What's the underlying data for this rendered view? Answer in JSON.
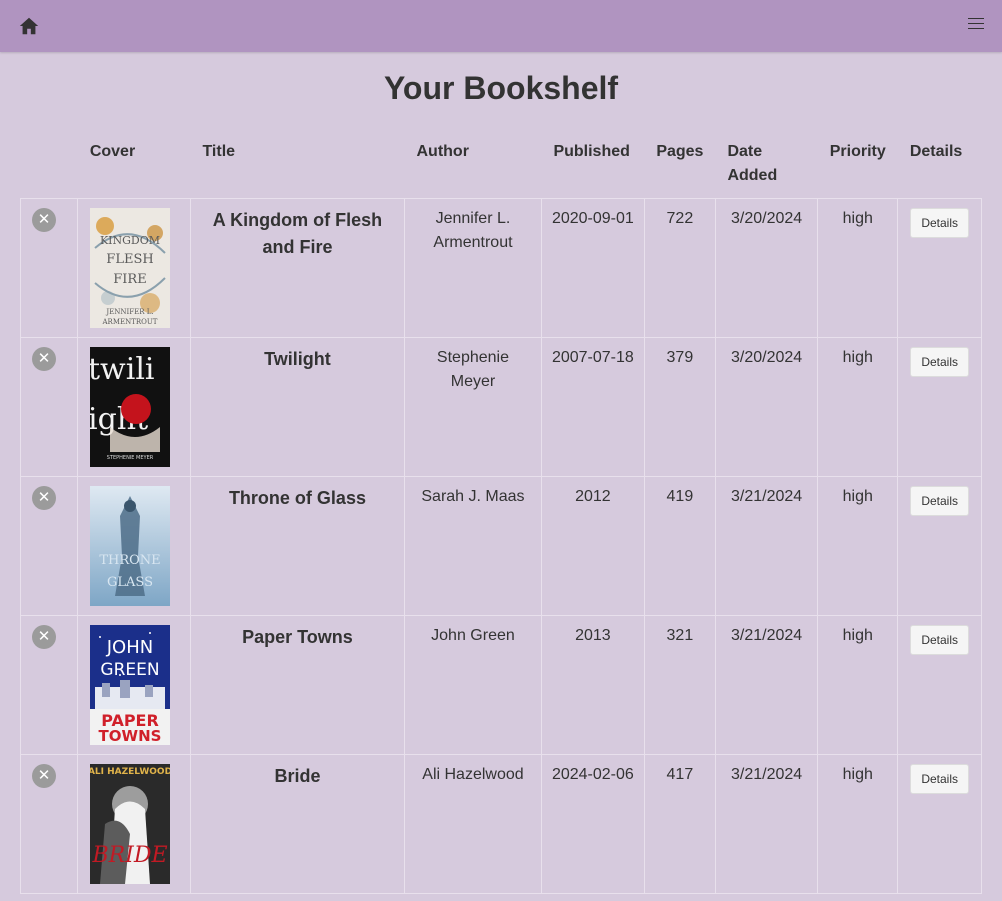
{
  "title": "Your Bookshelf",
  "columns": [
    "",
    "Cover",
    "Title",
    "Author",
    "Published",
    "Pages",
    "Date Added",
    "Priority",
    "Details"
  ],
  "books": [
    {
      "title": "A Kingdom of Flesh and Fire",
      "author": "Jennifer L. Armentrout",
      "published": "2020-09-01",
      "pages": "722",
      "date_added": "3/20/2024",
      "priority": "high",
      "details": "Details"
    },
    {
      "title": "Twilight",
      "author": "Stephenie Meyer",
      "published": "2007-07-18",
      "pages": "379",
      "date_added": "3/20/2024",
      "priority": "high",
      "details": "Details"
    },
    {
      "title": "Throne of Glass",
      "author": "Sarah J. Maas",
      "published": "2012",
      "pages": "419",
      "date_added": "3/21/2024",
      "priority": "high",
      "details": "Details"
    },
    {
      "title": "Paper Towns",
      "author": "John Green",
      "published": "2013",
      "pages": "321",
      "date_added": "3/21/2024",
      "priority": "high",
      "details": "Details"
    },
    {
      "title": "Bride",
      "author": "Ali Hazelwood",
      "published": "2024-02-06",
      "pages": "417",
      "date_added": "3/21/2024",
      "priority": "high",
      "details": "Details"
    }
  ],
  "remove_glyph": "✕",
  "icons": {
    "home": "home-icon",
    "menu": "hamburger-menu-icon",
    "remove": "close-icon"
  },
  "colors": {
    "topbar": "#b094c0",
    "background": "#d6cadd"
  }
}
